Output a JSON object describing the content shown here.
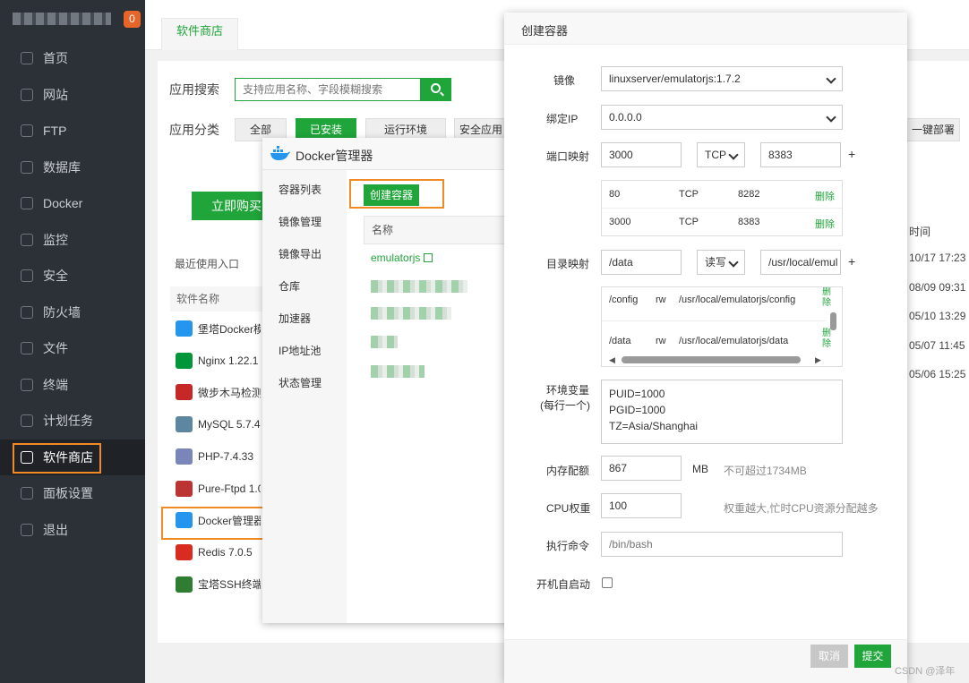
{
  "sidebar": {
    "badge": "0",
    "items": [
      {
        "label": "首页",
        "icon": "home-icon"
      },
      {
        "label": "网站",
        "icon": "globe-icon"
      },
      {
        "label": "FTP",
        "icon": "ftp-icon"
      },
      {
        "label": "数据库",
        "icon": "database-icon"
      },
      {
        "label": "Docker",
        "icon": "docker-icon"
      },
      {
        "label": "监控",
        "icon": "monitor-icon"
      },
      {
        "label": "安全",
        "icon": "shield-icon"
      },
      {
        "label": "防火墙",
        "icon": "firewall-icon"
      },
      {
        "label": "文件",
        "icon": "folder-icon"
      },
      {
        "label": "终端",
        "icon": "terminal-icon"
      },
      {
        "label": "计划任务",
        "icon": "clock-icon"
      },
      {
        "label": "软件商店",
        "icon": "grid-icon"
      },
      {
        "label": "面板设置",
        "icon": "gear-icon"
      },
      {
        "label": "退出",
        "icon": "logout-icon"
      }
    ]
  },
  "tabs": {
    "active": "软件商店"
  },
  "store": {
    "search_label": "应用搜索",
    "search_placeholder": "支持应用名称、字段模糊搜索",
    "category_label": "应用分类",
    "categories": [
      "全部",
      "已安装",
      "运行环境",
      "安全应用"
    ],
    "right_button": "一键部署",
    "buy_label": "立即购买",
    "recent_label": "最近使用入口",
    "soft_header": "软件名称",
    "software": [
      {
        "name": "堡塔Docker模",
        "color": "#2496ed"
      },
      {
        "name": "Nginx 1.22.1",
        "color": "#009639"
      },
      {
        "name": "微步木马检测",
        "color": "#c62828"
      },
      {
        "name": "MySQL 5.7.42",
        "color": "#5d87a1"
      },
      {
        "name": "PHP-7.4.33",
        "color": "#7a86b8"
      },
      {
        "name": "Pure-Ftpd 1.0",
        "color": "#b33"
      },
      {
        "name": "Docker管理器",
        "color": "#2496ed"
      },
      {
        "name": "Redis 7.0.5",
        "color": "#d82c20"
      },
      {
        "name": "宝塔SSH终端",
        "color": "#2e7d32"
      }
    ],
    "time_header": "时间",
    "times": [
      "10/17 17:23",
      "08/09 09:31",
      "05/10 13:29",
      "05/07 11:45",
      "05/06 15:25"
    ]
  },
  "docker": {
    "title": "Docker管理器",
    "menu": [
      "容器列表",
      "镜像管理",
      "镜像导出",
      "仓库",
      "加速器",
      "IP地址池",
      "状态管理"
    ],
    "create_button": "创建容器",
    "table_header": "名称",
    "container_name": "emulatorjs"
  },
  "create": {
    "title": "创建容器",
    "image_label": "镜像",
    "image_value": "linuxserver/emulatorjs:1.7.2",
    "ip_label": "绑定IP",
    "ip_value": "0.0.0.0",
    "port_label": "端口映射",
    "port_host": "3000",
    "port_proto": "TCP",
    "port_container": "8383",
    "plus": "+",
    "ports": [
      {
        "host": "80",
        "proto": "TCP",
        "container": "8282",
        "action": "删除"
      },
      {
        "host": "3000",
        "proto": "TCP",
        "container": "8383",
        "action": "删除"
      }
    ],
    "dir_label": "目录映射",
    "dir_host": "/data",
    "dir_mode": "读写",
    "dir_container": "/usr/local/emul",
    "dirs": [
      {
        "host": "/config",
        "mode": "rw",
        "container": "/usr/local/emulatorjs/config",
        "action": "删除"
      },
      {
        "host": "/data",
        "mode": "rw",
        "container": "/usr/local/emulatorjs/data",
        "action": "删除"
      }
    ],
    "env_label": "环境变量",
    "env_sub": "(每行一个)",
    "env_lines": [
      "PUID=1000",
      "PGID=1000",
      "TZ=Asia/Shanghai"
    ],
    "mem_label": "内存配额",
    "mem_value": "867",
    "mem_unit": "MB",
    "mem_note": "不可超过1734MB",
    "cpu_label": "CPU权重",
    "cpu_value": "100",
    "cpu_note": "权重越大,忙时CPU资源分配越多",
    "cmd_label": "执行命令",
    "cmd_placeholder": "/bin/bash",
    "autostart_label": "开机自启动",
    "cancel": "取消",
    "submit": "提交"
  },
  "watermark": "CSDN @泽年"
}
